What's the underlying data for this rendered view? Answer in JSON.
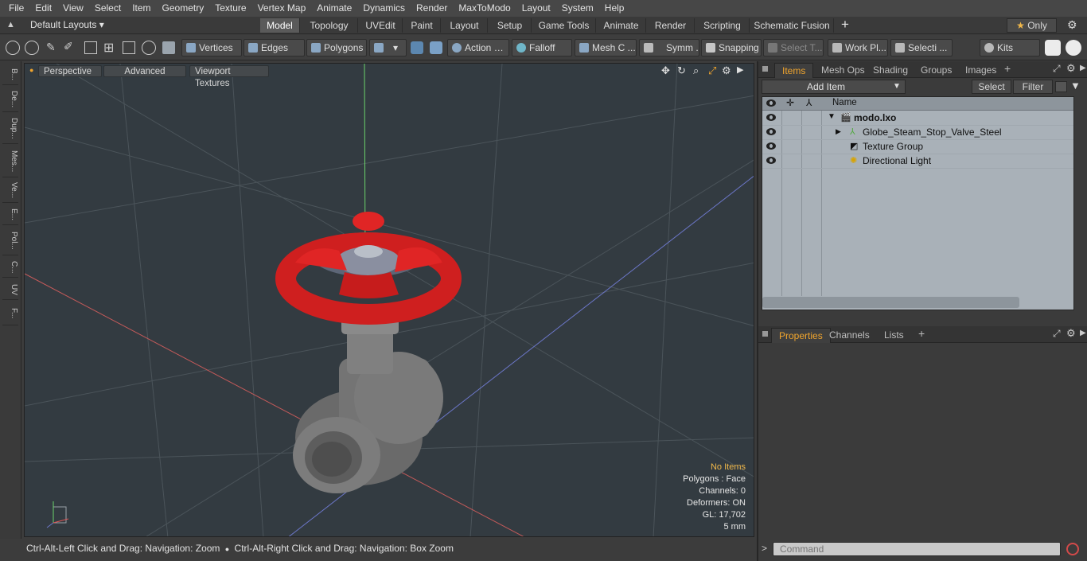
{
  "menu": [
    "File",
    "Edit",
    "View",
    "Select",
    "Item",
    "Geometry",
    "Texture",
    "Vertex Map",
    "Animate",
    "Dynamics",
    "Render",
    "MaxToModo",
    "Layout",
    "System",
    "Help"
  ],
  "layout_selector": "Default Layouts",
  "layout_tabs": [
    "Model",
    "Topology",
    "UVEdit",
    "Paint",
    "Layout",
    "Setup",
    "Game Tools",
    "Animate",
    "Render",
    "Scripting",
    "Schematic Fusion"
  ],
  "only_label": "Only",
  "toolbar": {
    "vertices": "Vertices",
    "edges": "Edges",
    "polygons": "Polygons",
    "action": "Action",
    "falloff": "Falloff",
    "mesh": "Mesh C ...",
    "symm": "Symm ...",
    "snapping": "Snapping",
    "select_t": "Select T...",
    "work_pl": "Work Pl...",
    "selecti": "Selecti ...",
    "kits": "Kits"
  },
  "left_tabs": [
    "B...",
    "De...",
    "Dup...",
    "Mes...",
    "Ve...",
    "E...",
    "Pol...",
    "C...",
    "UV",
    "F..."
  ],
  "viewport": {
    "perspective": "Perspective",
    "advanced": "Advanced",
    "viewport_textures": "Viewport Textures",
    "info": {
      "no_items": "No Items",
      "polygons": "Polygons : Face",
      "channels": "Channels: 0",
      "deformers": "Deformers: ON",
      "gl": "GL: 17,702",
      "scale": "5 mm"
    }
  },
  "status": {
    "hint_a": "Ctrl-Alt-Left Click and Drag: Navigation: Zoom",
    "hint_b": "Ctrl-Alt-Right Click and Drag: Navigation: Box Zoom"
  },
  "items_panel": {
    "tabs": [
      "Items",
      "Mesh Ops",
      "Shading",
      "Groups",
      "Images"
    ],
    "add_item": "Add Item",
    "select": "Select",
    "filter": "Filter",
    "name_header": "Name",
    "rows": [
      "modo.lxo",
      "Globe_Steam_Stop_Valve_Steel",
      "Texture Group",
      "Directional Light"
    ]
  },
  "properties_panel": {
    "tabs": [
      "Properties",
      "Channels",
      "Lists"
    ]
  },
  "command_placeholder": "Command",
  "colors": {
    "accent": "#f1a52d",
    "handle_red": "#d81e1e",
    "valve_gray": "#6e6e6e"
  }
}
